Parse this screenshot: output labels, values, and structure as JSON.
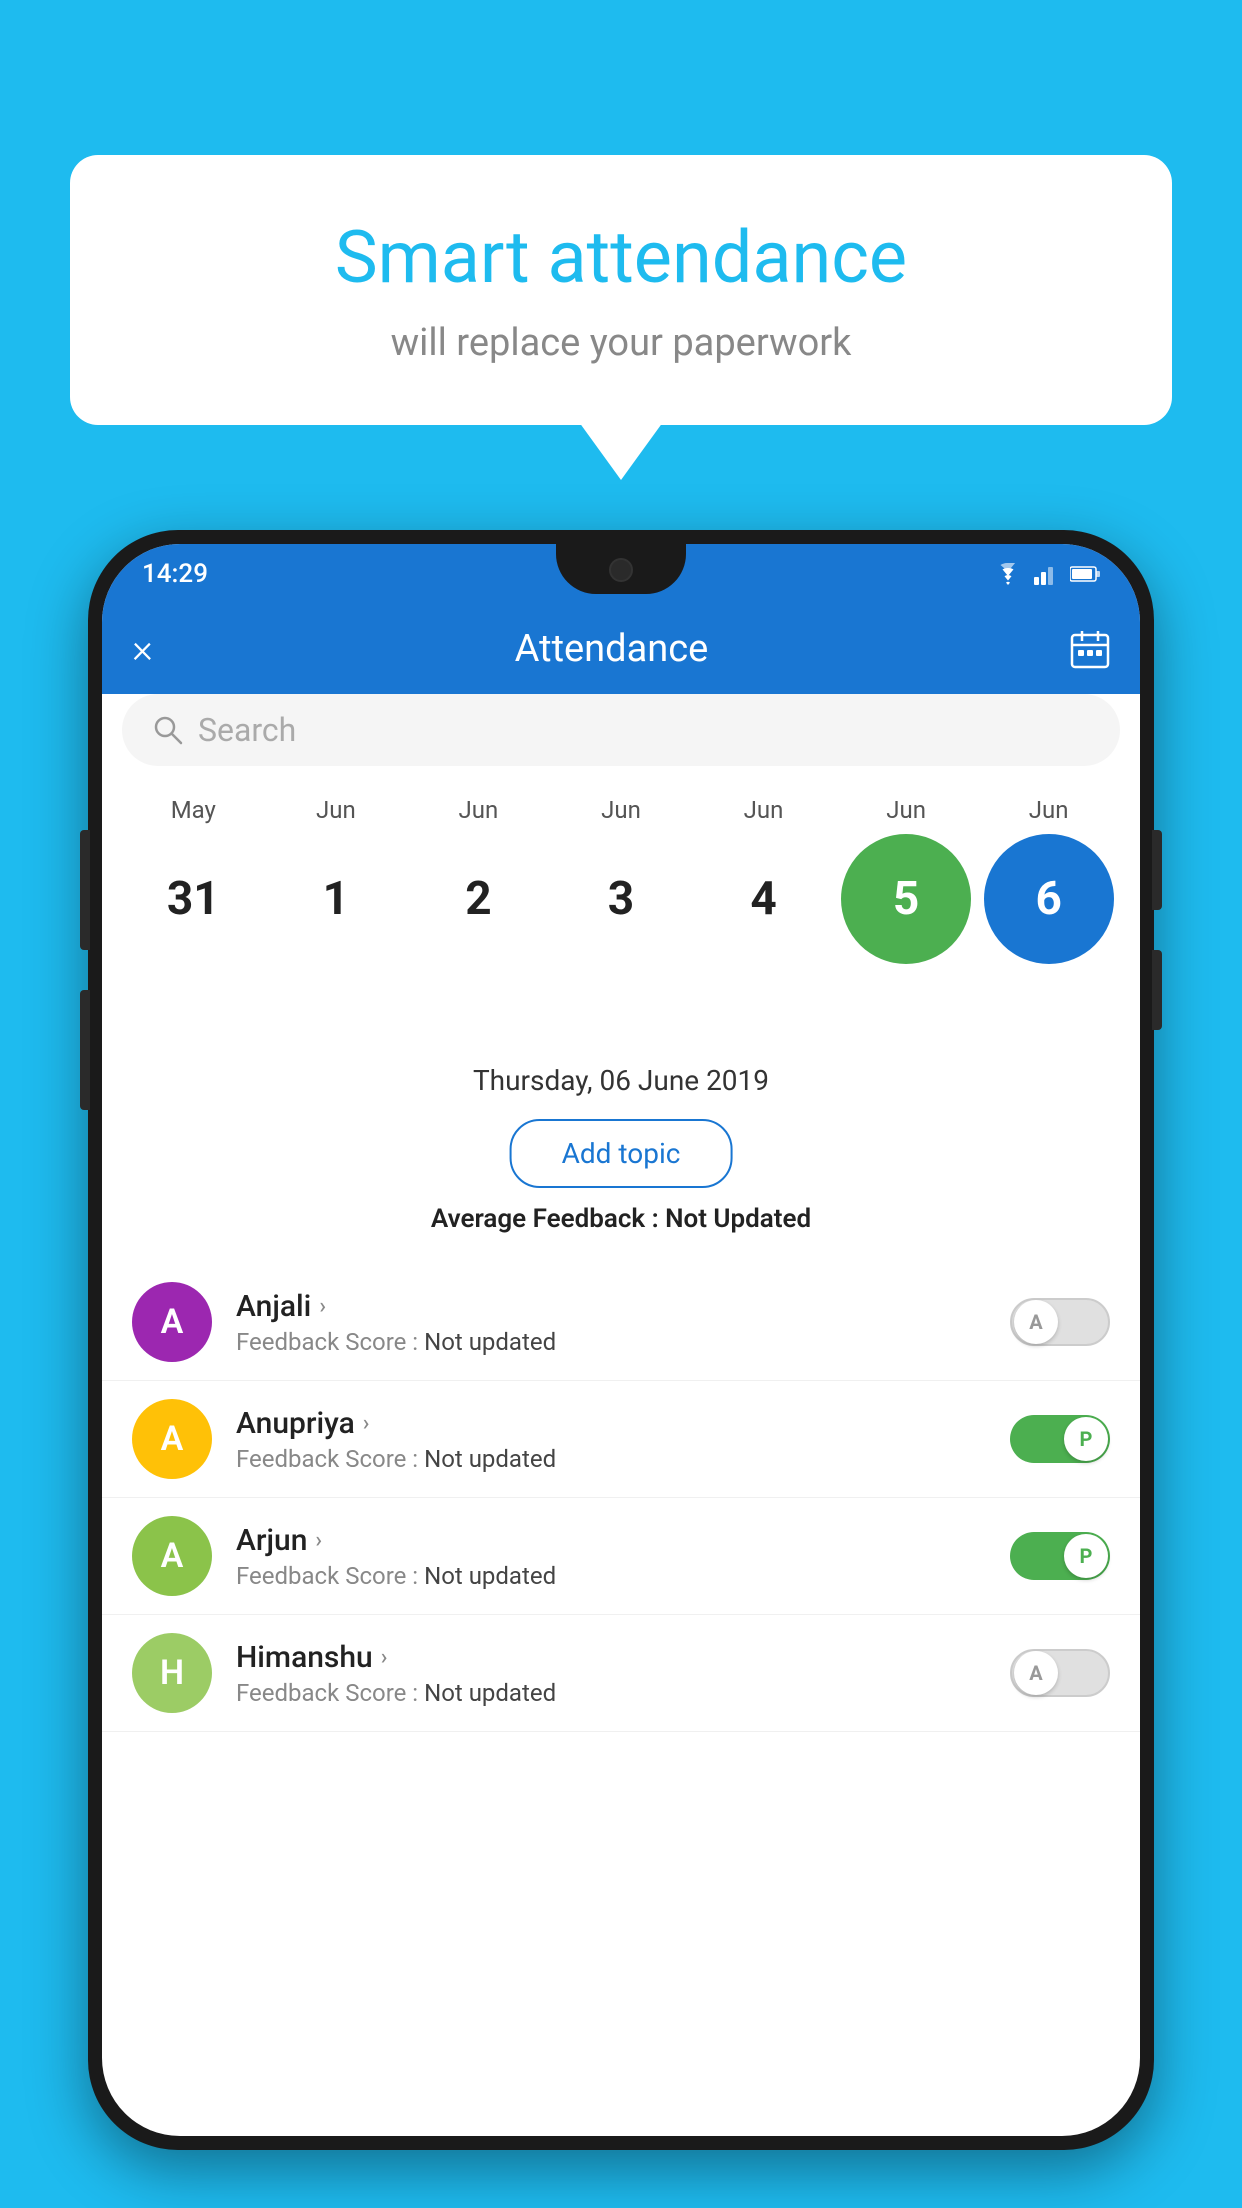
{
  "background_color": "#1EBBEF",
  "speech_bubble": {
    "title": "Smart attendance",
    "subtitle": "will replace your paperwork"
  },
  "status_bar": {
    "time": "14:29",
    "icons": [
      "wifi",
      "signal",
      "battery"
    ]
  },
  "header": {
    "title": "Attendance",
    "close_label": "×",
    "calendar_icon": "calendar"
  },
  "search": {
    "placeholder": "Search"
  },
  "calendar": {
    "months": [
      "May",
      "Jun",
      "Jun",
      "Jun",
      "Jun",
      "Jun",
      "Jun"
    ],
    "dates": [
      "31",
      "1",
      "2",
      "3",
      "4",
      "5",
      "6"
    ],
    "today_index": 5,
    "selected_index": 6
  },
  "selected_date_label": "Thursday, 06 June 2019",
  "add_topic_button": "Add topic",
  "avg_feedback_label": "Average Feedback :",
  "avg_feedback_value": "Not Updated",
  "students": [
    {
      "name": "Anjali",
      "avatar_letter": "A",
      "avatar_color": "#9C27B0",
      "score_label": "Feedback Score :",
      "score_value": "Not updated",
      "toggle_state": "off",
      "toggle_label": "A"
    },
    {
      "name": "Anupriya",
      "avatar_letter": "A",
      "avatar_color": "#FFC107",
      "score_label": "Feedback Score :",
      "score_value": "Not updated",
      "toggle_state": "on",
      "toggle_label": "P"
    },
    {
      "name": "Arjun",
      "avatar_letter": "A",
      "avatar_color": "#8BC34A",
      "score_label": "Feedback Score :",
      "score_value": "Not updated",
      "toggle_state": "on",
      "toggle_label": "P"
    },
    {
      "name": "Himanshu",
      "avatar_letter": "H",
      "avatar_color": "#9CCC65",
      "score_label": "Feedback Score :",
      "score_value": "Not updated",
      "toggle_state": "off",
      "toggle_label": "A"
    }
  ]
}
